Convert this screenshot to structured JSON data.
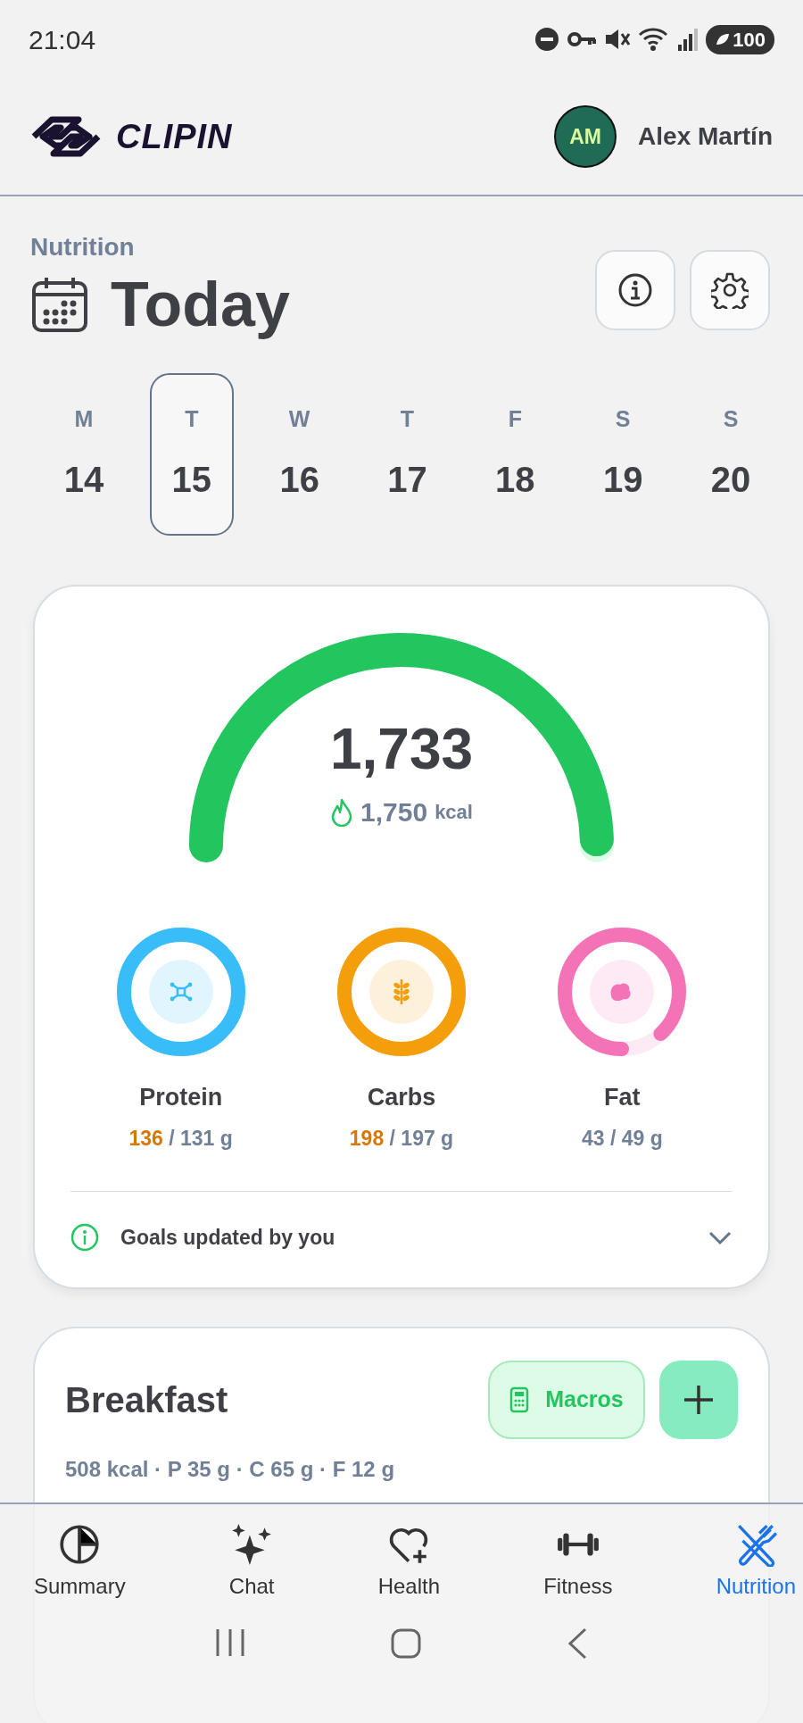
{
  "status_bar": {
    "time": "21:04",
    "battery": "100"
  },
  "header": {
    "brand": "CLIPIN",
    "user": {
      "initials": "AM",
      "name": "Alex Martín"
    }
  },
  "page": {
    "section": "Nutrition",
    "title": "Today"
  },
  "days": [
    {
      "letter": "M",
      "number": "14",
      "selected": false
    },
    {
      "letter": "T",
      "number": "15",
      "selected": true
    },
    {
      "letter": "W",
      "number": "16",
      "selected": false
    },
    {
      "letter": "T",
      "number": "17",
      "selected": false
    },
    {
      "letter": "F",
      "number": "18",
      "selected": false
    },
    {
      "letter": "S",
      "number": "19",
      "selected": false
    },
    {
      "letter": "S",
      "number": "20",
      "selected": false
    }
  ],
  "calories": {
    "eaten": "1,733",
    "goal": "1,750",
    "unit": "kcal",
    "level": 0.99
  },
  "macros": [
    {
      "kind": "protein",
      "label": "Protein",
      "amount": "136",
      "goal": "/ 131 g",
      "over": true,
      "level": 1,
      "color": "#38bdf8"
    },
    {
      "kind": "carbs",
      "label": "Carbs",
      "amount": "198",
      "goal": "/ 197 g",
      "over": true,
      "level": 1,
      "color": "#f59e0b"
    },
    {
      "kind": "fat",
      "label": "Fat",
      "amount": "43",
      "goal": "/ 49 g",
      "over": false,
      "level": 0.88,
      "color": "#f472b6"
    }
  ],
  "goals_note": {
    "text": "Goals updated by you",
    "expanded": false
  },
  "meal": {
    "title": "Breakfast",
    "macros_button": "Macros",
    "summary": "508 kcal · P 35 g · C 65 g · F 12 g"
  },
  "bottom_nav": [
    {
      "kind": "summary",
      "label": "Summary",
      "selected": false
    },
    {
      "kind": "chat",
      "label": "Chat",
      "selected": false
    },
    {
      "kind": "health",
      "label": "Health",
      "selected": false
    },
    {
      "kind": "fitness",
      "label": "Fitness",
      "selected": false
    },
    {
      "kind": "nutrition",
      "label": "Nutrition",
      "selected": true
    }
  ]
}
